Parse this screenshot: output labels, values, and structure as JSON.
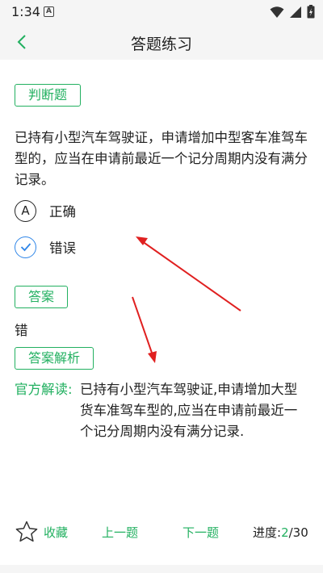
{
  "status_bar": {
    "time": "1:34",
    "a_badge": "A"
  },
  "header": {
    "title": "答题练习",
    "back_icon": "chevron-left-icon"
  },
  "question": {
    "type_label": "判断题",
    "text": "已持有小型汽车驾驶证，申请增加中型客车准驾车型的，应当在申请前最近一个记分周期内没有满分记录。",
    "options": [
      {
        "letter": "A",
        "label": "正确",
        "selected": false
      },
      {
        "letter": "",
        "label": "错误",
        "selected": true
      }
    ]
  },
  "answer": {
    "label": "答案",
    "value": "错"
  },
  "analysis": {
    "label": "答案解析",
    "source_label": "官方解读:",
    "text": "已持有小型汽车驾驶证,申请增加大型货车准驾车型的,应当在申请前最近一个记分周期内没有满分记录."
  },
  "bottom_bar": {
    "favorite_label": "收藏",
    "prev_label": "上一题",
    "next_label": "下一题",
    "progress_label": "进度:",
    "progress_current": "2",
    "progress_total": "/30"
  },
  "colors": {
    "accent": "#22b060",
    "check": "#2f86e8",
    "arrow": "#e02020",
    "header_bg": "#f5f5f5"
  }
}
